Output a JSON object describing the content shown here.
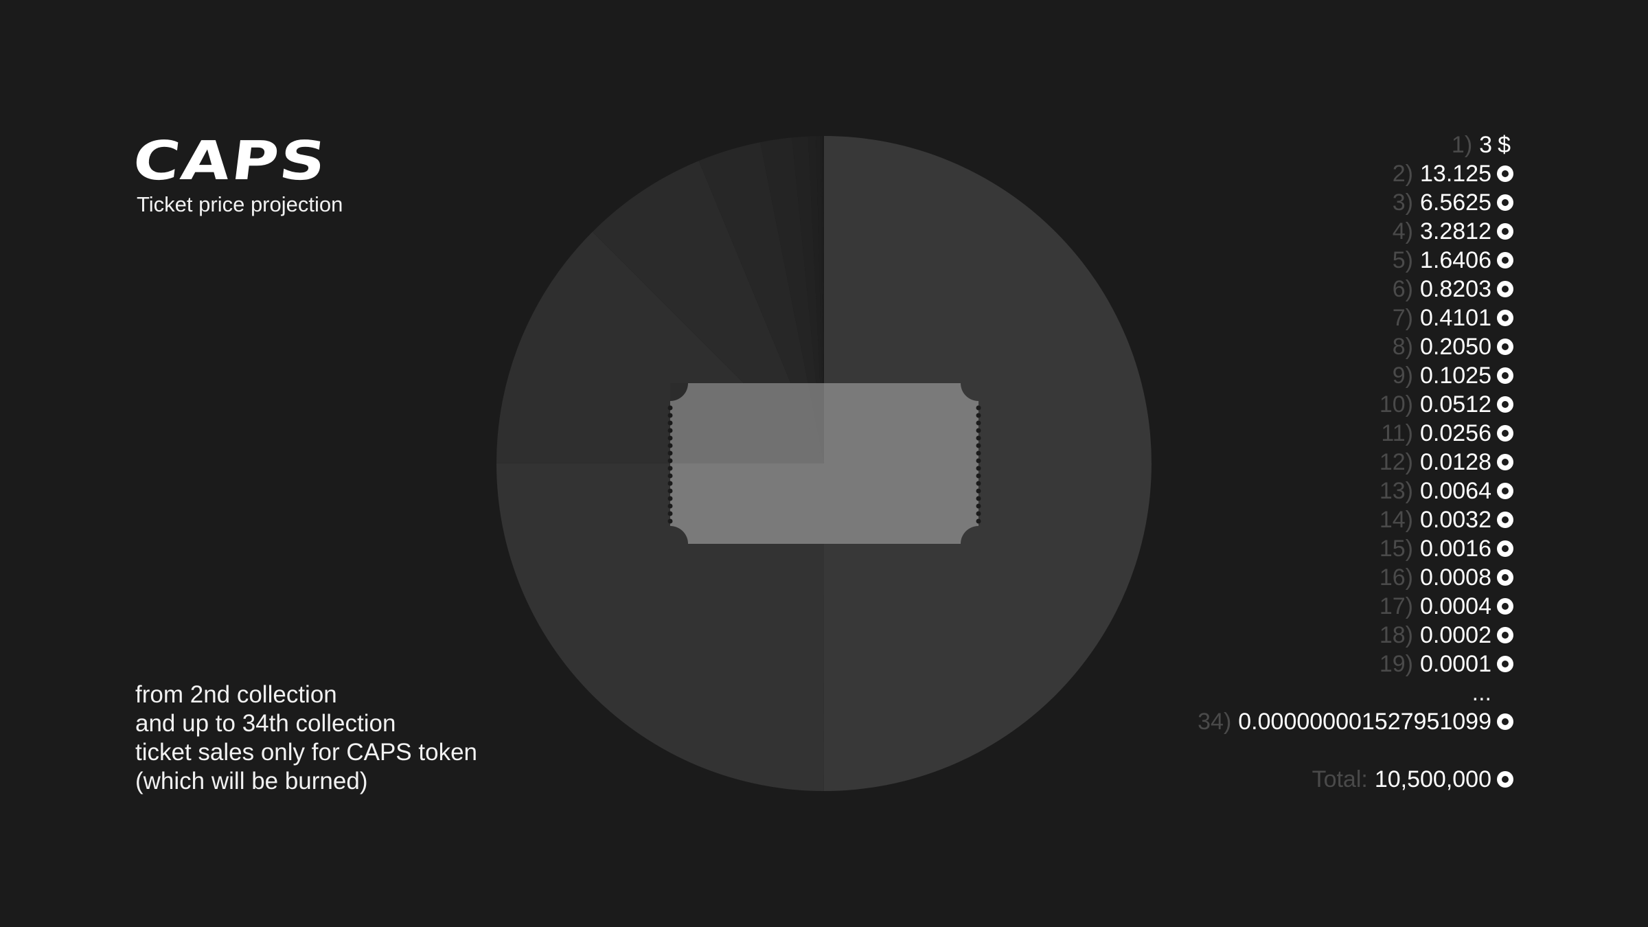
{
  "brand": {
    "logo_text": "CAPS",
    "subtitle": "Ticket price projection"
  },
  "note_lines": [
    "from 2nd collection",
    "and up to 34th collection",
    "ticket sales only for CAPS token",
    "(which will be burned)"
  ],
  "values_list": {
    "first": {
      "index": "1)",
      "value": "3",
      "unit": "$"
    },
    "items": [
      {
        "index": "2)",
        "value": "13.125"
      },
      {
        "index": "3)",
        "value": "6.5625"
      },
      {
        "index": "4)",
        "value": "3.2812"
      },
      {
        "index": "5)",
        "value": "1.6406"
      },
      {
        "index": "6)",
        "value": "0.8203"
      },
      {
        "index": "7)",
        "value": "0.4101"
      },
      {
        "index": "8)",
        "value": "0.2050"
      },
      {
        "index": "9)",
        "value": "0.1025"
      },
      {
        "index": "10)",
        "value": "0.0512"
      },
      {
        "index": "11)",
        "value": "0.0256"
      },
      {
        "index": "12)",
        "value": "0.0128"
      },
      {
        "index": "13)",
        "value": "0.0064"
      },
      {
        "index": "14)",
        "value": "0.0032"
      },
      {
        "index": "15)",
        "value": "0.0016"
      },
      {
        "index": "16)",
        "value": "0.0008"
      },
      {
        "index": "17)",
        "value": "0.0004"
      },
      {
        "index": "18)",
        "value": "0.0002"
      },
      {
        "index": "19)",
        "value": "0.0001"
      }
    ],
    "ellipsis": "...",
    "last": {
      "index": "34)",
      "value": "0.000000001527951099"
    },
    "total_label": "Total:",
    "total_value": "10,500,000"
  },
  "chart_data": {
    "type": "pie",
    "title": "",
    "start": "top",
    "direction": "clockwise",
    "slices": [
      {
        "label": "2)",
        "value": 13.125,
        "color": "#383838"
      },
      {
        "label": "3)",
        "value": 6.5625,
        "color": "#333333"
      },
      {
        "label": "4)",
        "value": 3.2812,
        "color": "#2f2f2f"
      },
      {
        "label": "5)",
        "value": 1.6406,
        "color": "#2b2b2b"
      },
      {
        "label": "6)",
        "value": 0.8203,
        "color": "#272727"
      },
      {
        "label": "7)",
        "value": 0.4101,
        "color": "#242424"
      },
      {
        "label": "8)",
        "value": 0.205,
        "color": "#222222"
      },
      {
        "label": "9)",
        "value": 0.1025,
        "color": "#202020"
      },
      {
        "label": "10)",
        "value": 0.0512,
        "color": "#1f1f1f"
      },
      {
        "label": "11)",
        "value": 0.0256,
        "color": "#1e1e1e"
      },
      {
        "label": "12)",
        "value": 0.0128,
        "color": "#1d1d1d"
      },
      {
        "label": "13)",
        "value": 0.0064,
        "color": "#1d1d1d"
      },
      {
        "label": "14)",
        "value": 0.0032,
        "color": "#1c1c1c"
      },
      {
        "label": "15)",
        "value": 0.0016,
        "color": "#1c1c1c"
      }
    ],
    "center_icon": "ticket-icon",
    "icon_color": "#808080"
  }
}
